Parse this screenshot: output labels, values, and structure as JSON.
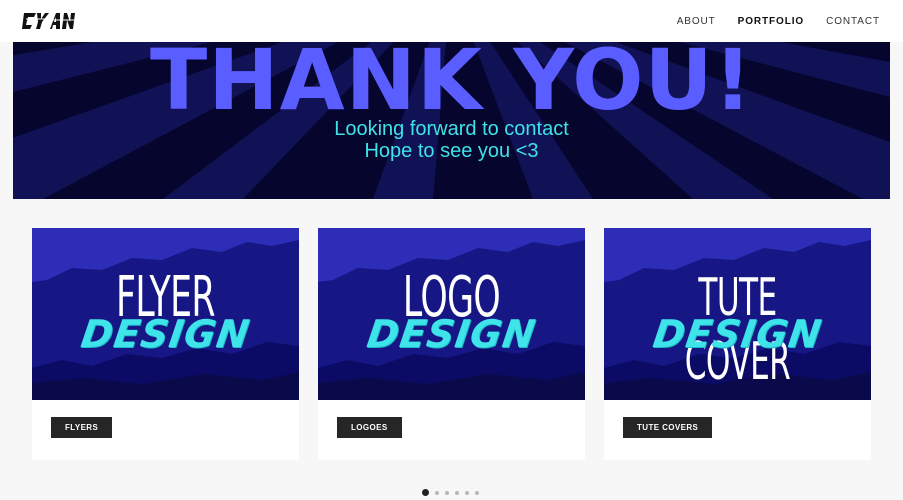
{
  "brand": {
    "logo_text": "CYAN"
  },
  "nav": {
    "items": [
      {
        "label": "ABOUT",
        "active": false
      },
      {
        "label": "PORTFOLIO",
        "active": true
      },
      {
        "label": "CONTACT",
        "active": false
      }
    ]
  },
  "hero": {
    "title": "THANK YOU!",
    "line1": "Looking forward to contact",
    "line2": "Hope to see you <3"
  },
  "cards": [
    {
      "title": "FLYER",
      "script": "DESIGN",
      "tag": "FLYERS"
    },
    {
      "title": "LOGO",
      "script": "DESIGN",
      "tag": "LOGOES"
    },
    {
      "title": "TUTE COVER",
      "script": "DESIGN",
      "tag": "TUTE COVERS"
    }
  ],
  "pager": {
    "count": 6,
    "active_index": 0
  },
  "colors": {
    "accent_purple": "#5a5dff",
    "accent_cyan": "#3fe2e6",
    "hero_bg": "#05052e",
    "card_bg": "#141482",
    "tag_bg": "#262626"
  }
}
